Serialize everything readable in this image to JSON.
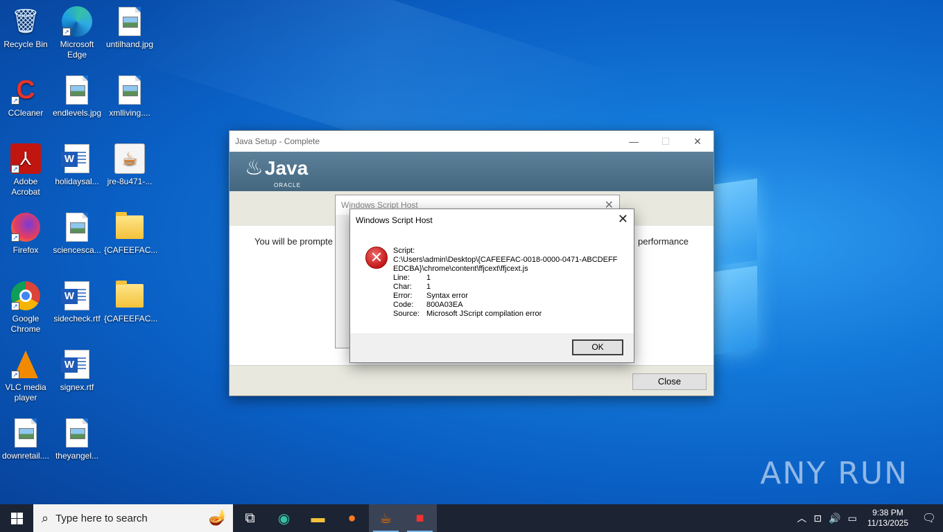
{
  "desktop": {
    "icons": [
      {
        "label": "Recycle Bin"
      },
      {
        "label": "Microsoft Edge"
      },
      {
        "label": "untilhand.jpg"
      },
      {
        "label": "CCleaner"
      },
      {
        "label": "endlevels.jpg"
      },
      {
        "label": "xmlliving...."
      },
      {
        "label": "Adobe Acrobat"
      },
      {
        "label": "holidaysal..."
      },
      {
        "label": "jre-8u471-..."
      },
      {
        "label": "Firefox"
      },
      {
        "label": "sciencesca..."
      },
      {
        "label": "{CAFEEFAC..."
      },
      {
        "label": "Google Chrome"
      },
      {
        "label": "sidecheck.rtf"
      },
      {
        "label": "{CAFEEFAC..."
      },
      {
        "label": "VLC media player"
      },
      {
        "label": "signex.rtf"
      },
      {
        "label": "downretail...."
      },
      {
        "label": "theyangel..."
      }
    ],
    "watermark": "ANY RUN"
  },
  "java_window": {
    "title": "Java Setup - Complete",
    "logo_text": "Java",
    "logo_sub": "ORACLE",
    "body_left": "You will be prompte",
    "body_right": "performance",
    "close_button": "Close"
  },
  "wsh_back": {
    "title": "Windows Script Host"
  },
  "wsh_dialog": {
    "title": "Windows Script Host",
    "script_label": "Script:",
    "script_path_1": "C:\\Users\\admin\\Desktop\\{CAFEEFAC-0018-0000-0471-ABCDEFF",
    "script_path_2": "EDCBA}\\chrome\\content\\ffjcext\\ffjcext.js",
    "fields": [
      {
        "key": "Line:",
        "value": "1"
      },
      {
        "key": "Char:",
        "value": "1"
      },
      {
        "key": "Error:",
        "value": "Syntax error"
      },
      {
        "key": "Code:",
        "value": "800A03EA"
      },
      {
        "key": "Source:",
        "value": "Microsoft JScript compilation error"
      }
    ],
    "ok_button": "OK"
  },
  "taskbar": {
    "search_placeholder": "Type here to search",
    "time": "9:38 PM",
    "date": "11/13/2025"
  }
}
